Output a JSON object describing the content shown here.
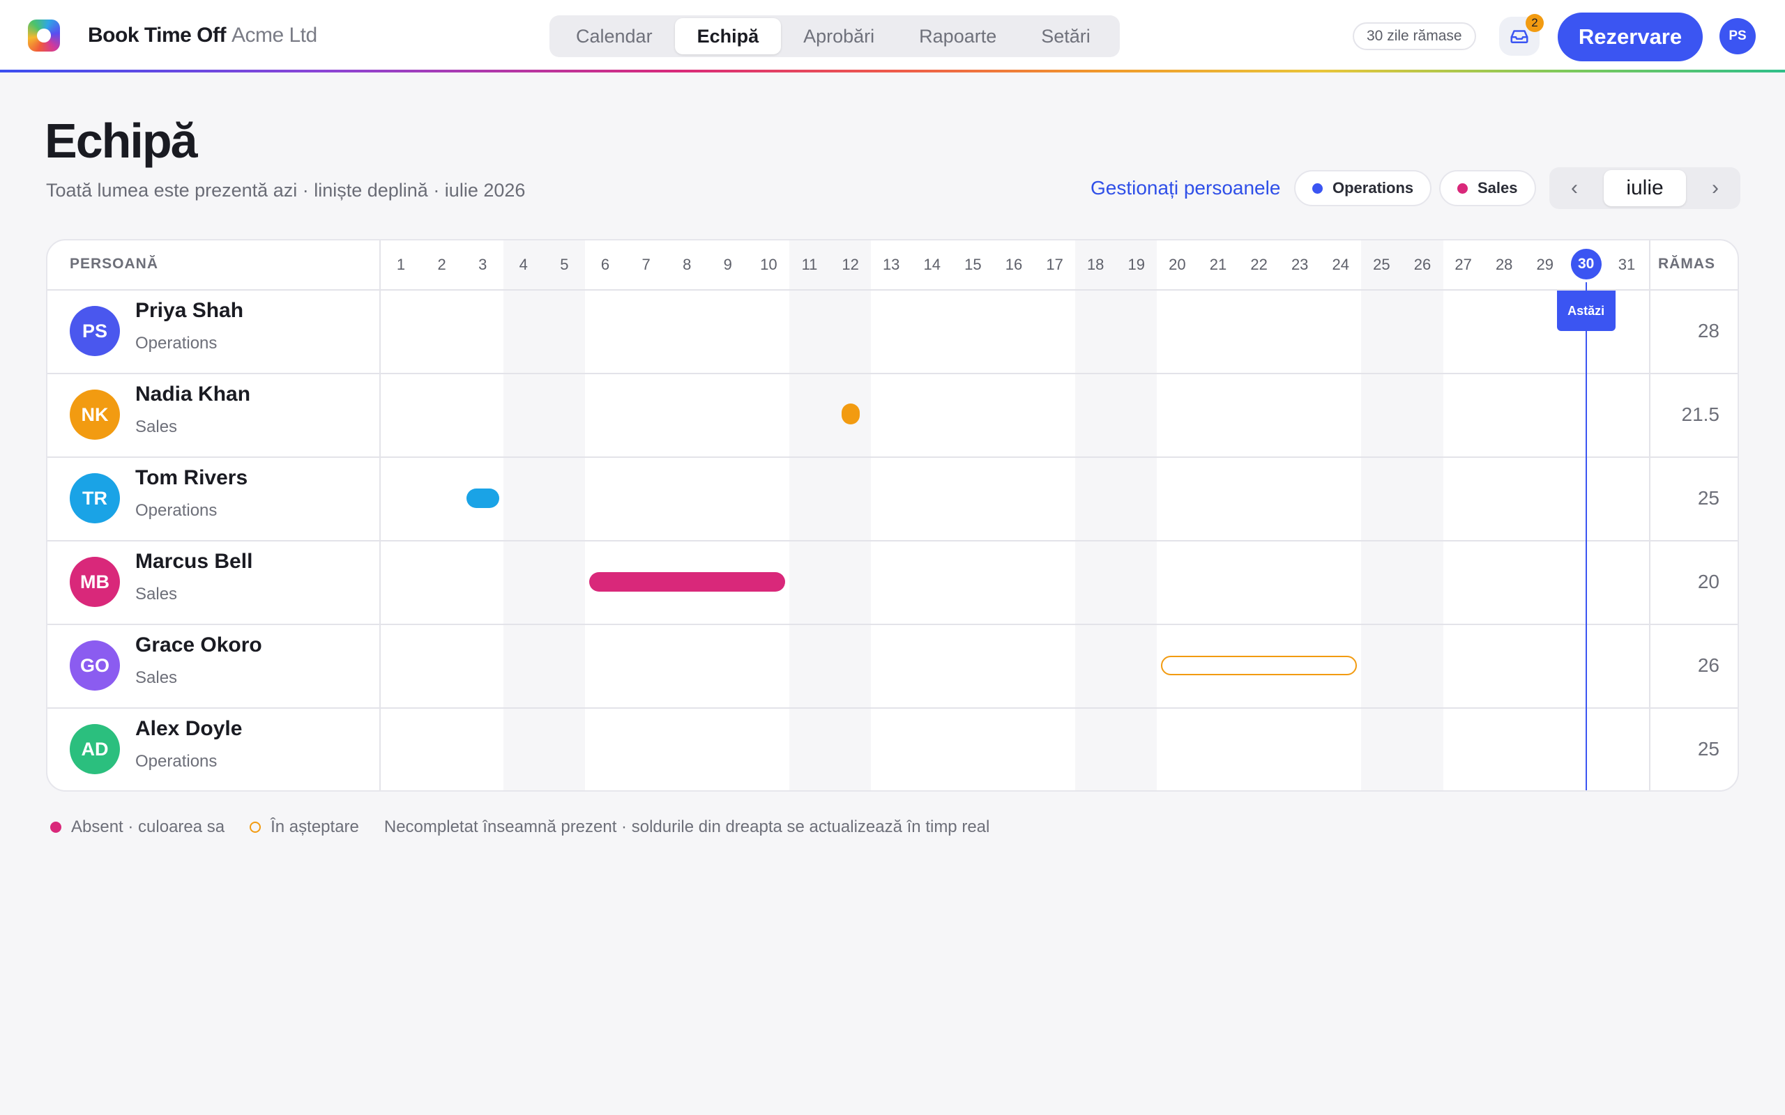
{
  "header": {
    "app_name": "Book Time Off",
    "company": "Acme Ltd",
    "tabs": [
      {
        "label": "Calendar",
        "active": false
      },
      {
        "label": "Echipă",
        "active": true
      },
      {
        "label": "Aprobări",
        "active": false
      },
      {
        "label": "Rapoarte",
        "active": false
      },
      {
        "label": "Setări",
        "active": false
      }
    ],
    "days_left": "30 zile rămase",
    "inbox_count": "2",
    "book_button": "Rezervare",
    "user_initials": "PS"
  },
  "page": {
    "title": "Echipă",
    "subtitle": "Toată lumea este prezentă azi · liniște deplină · iulie 2026",
    "manage_link": "Gestionați persoanele",
    "filters": [
      {
        "label": "Operations",
        "color": "#3b55f2"
      },
      {
        "label": "Sales",
        "color": "#d9287a"
      }
    ],
    "month": "iulie",
    "prev_arrow": "‹",
    "next_arrow": "›"
  },
  "grid": {
    "person_header": "PERSOANĂ",
    "remaining_header": "RĂMAS",
    "days": [
      "1",
      "2",
      "3",
      "4",
      "5",
      "6",
      "7",
      "8",
      "9",
      "10",
      "11",
      "12",
      "13",
      "14",
      "15",
      "16",
      "17",
      "18",
      "19",
      "20",
      "21",
      "22",
      "23",
      "24",
      "25",
      "26",
      "27",
      "28",
      "29",
      "30",
      "31"
    ],
    "weekend_days": [
      4,
      5,
      11,
      12,
      18,
      19,
      25,
      26
    ],
    "today": 30,
    "today_label": "Astăzi",
    "people": [
      {
        "initials": "PS",
        "name": "Priya Shah",
        "team": "Operations",
        "remaining": "28",
        "avatar_color": "#4a57ee",
        "absences": []
      },
      {
        "initials": "NK",
        "name": "Nadia Khan",
        "team": "Sales",
        "remaining": "21.5",
        "avatar_color": "#f29b11",
        "absences": [
          {
            "start": 12,
            "end": 12,
            "half": true,
            "status": "approved",
            "color": "#f29b11"
          }
        ]
      },
      {
        "initials": "TR",
        "name": "Tom Rivers",
        "team": "Operations",
        "remaining": "25",
        "avatar_color": "#1aa3e6",
        "absences": [
          {
            "start": 3,
            "end": 3,
            "half": false,
            "status": "approved",
            "color": "#1aa3e6"
          }
        ]
      },
      {
        "initials": "MB",
        "name": "Marcus Bell",
        "team": "Sales",
        "remaining": "20",
        "avatar_color": "#d9287a",
        "absences": [
          {
            "start": 6,
            "end": 10,
            "half": false,
            "status": "approved",
            "color": "#d9287a"
          }
        ]
      },
      {
        "initials": "GO",
        "name": "Grace Okoro",
        "team": "Sales",
        "remaining": "26",
        "avatar_color": "#8b5cf0",
        "absences": [
          {
            "start": 20,
            "end": 24,
            "half": false,
            "status": "pending",
            "color": "#f29b11"
          }
        ]
      },
      {
        "initials": "AD",
        "name": "Alex Doyle",
        "team": "Operations",
        "remaining": "25",
        "avatar_color": "#2bbf7e",
        "absences": []
      }
    ]
  },
  "legend": {
    "absent": "Absent · culoarea sa",
    "absent_color": "#d9287a",
    "pending": "În așteptare",
    "pending_color": "#f29b11",
    "note": "Necompletat înseamnă prezent · soldurile din dreapta se actualizează în timp real"
  }
}
